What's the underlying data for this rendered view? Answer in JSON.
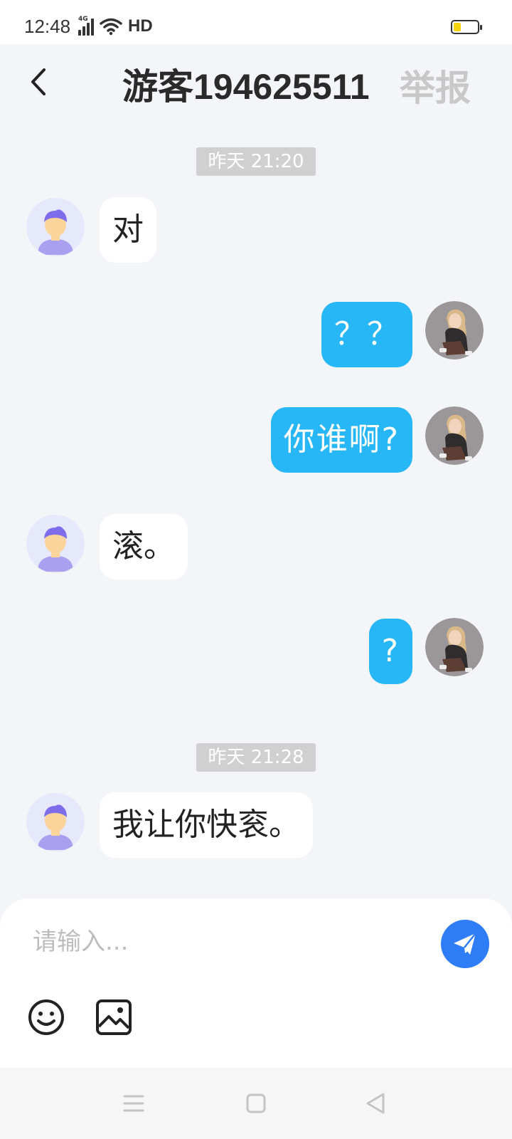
{
  "status_bar": {
    "time": "12:48",
    "network": "4G",
    "wifi_label": "HD",
    "battery_level": 0.3,
    "battery_color": "#F5D30F"
  },
  "header": {
    "title": "游客194625511",
    "report_label": "举报",
    "back_icon": "chevron-left-icon"
  },
  "timestamps": {
    "first": "昨天 21:20",
    "second": "昨天 21:28"
  },
  "messages": [
    {
      "side": "incoming",
      "text": "对",
      "avatar": "default-user-avatar"
    },
    {
      "side": "outgoing",
      "text": "？？",
      "avatar": "user-photo-avatar"
    },
    {
      "side": "outgoing",
      "text": "你谁啊?",
      "avatar": "user-photo-avatar"
    },
    {
      "side": "incoming",
      "text": "滚。",
      "avatar": "default-user-avatar"
    },
    {
      "side": "outgoing",
      "text": "?",
      "avatar": "user-photo-avatar"
    },
    {
      "side": "incoming",
      "text": "我让你快衮。",
      "avatar": "default-user-avatar"
    }
  ],
  "composer": {
    "placeholder": "请输入...",
    "value": "",
    "send_icon": "paper-plane-icon",
    "tools": [
      "emoji-icon",
      "image-icon"
    ]
  },
  "colors": {
    "background": "#F4F5F8",
    "outgoing_bubble": "#27B6F6",
    "incoming_bubble": "#FFFFFF",
    "send_button": "#2E7CF6",
    "timestamp_bg": "#D0D0D0",
    "report_text": "#C8C8C8"
  },
  "nav_bar": [
    "menu-icon",
    "home-square-icon",
    "back-triangle-icon"
  ]
}
